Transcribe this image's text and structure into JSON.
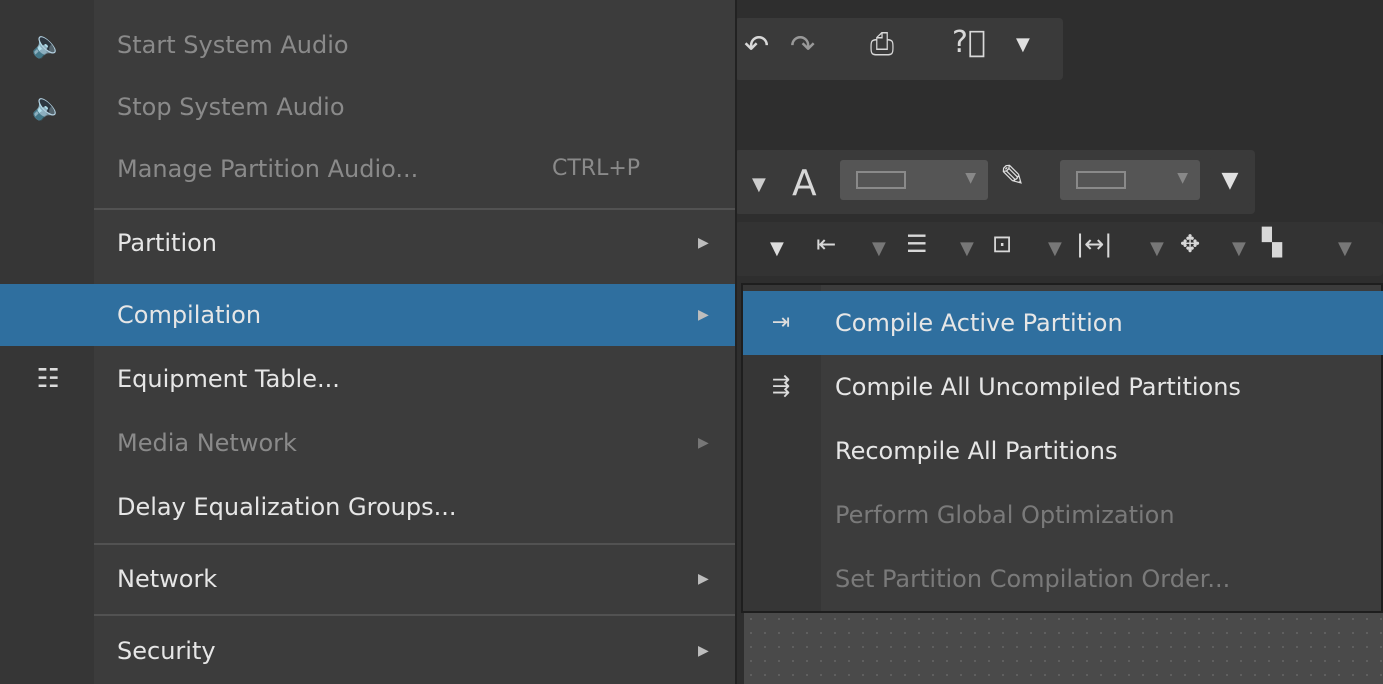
{
  "menu": {
    "items": [
      {
        "label": "Start System Audio",
        "icon": "speaker-play-icon",
        "enabled": false
      },
      {
        "label": "Stop System Audio",
        "icon": "speaker-stop-icon",
        "enabled": false
      },
      {
        "label": "Manage Partition Audio...",
        "shortcut": "CTRL+P",
        "enabled": false
      },
      {
        "label": "Partition",
        "submenu": true,
        "enabled": true
      },
      {
        "label": "Compilation",
        "submenu": true,
        "enabled": true,
        "selected": true
      },
      {
        "label": "Equipment Table...",
        "icon": "table-list-icon",
        "enabled": true
      },
      {
        "label": "Media Network",
        "submenu": true,
        "enabled": false
      },
      {
        "label": "Delay Equalization Groups...",
        "enabled": true
      },
      {
        "label": "Network",
        "submenu": true,
        "enabled": true
      },
      {
        "label": "Security",
        "submenu": true,
        "enabled": true
      }
    ]
  },
  "submenu": {
    "items": [
      {
        "label": "Compile Active Partition",
        "icon": "compile-active-icon",
        "selected": true,
        "enabled": true
      },
      {
        "label": "Compile All Uncompiled Partitions",
        "icon": "compile-all-icon",
        "enabled": true
      },
      {
        "label": "Recompile All Partitions",
        "enabled": true
      },
      {
        "label": "Perform Global Optimization",
        "enabled": false
      },
      {
        "label": "Set Partition Compilation Order...",
        "enabled": false
      }
    ]
  },
  "toolbar": {
    "text_color_glyph": "A"
  },
  "colors": {
    "highlight": "#2f6f9f",
    "menu_bg": "#3c3c3c",
    "text": "#e6e6e6",
    "disabled_text": "#8a8a8a"
  }
}
